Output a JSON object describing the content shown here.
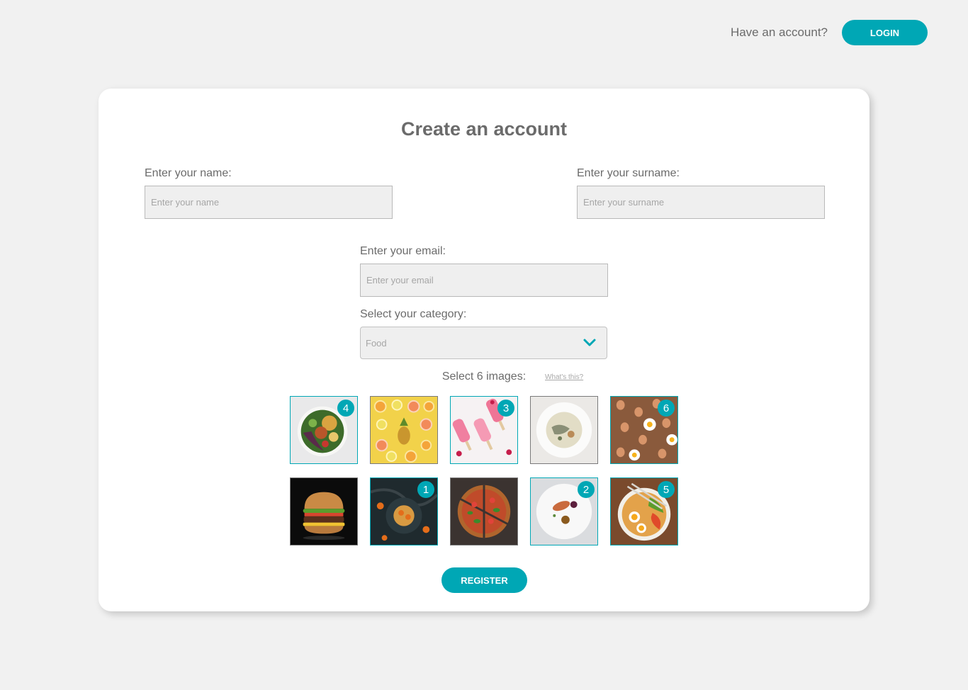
{
  "header": {
    "have_account_text": "Have an account?",
    "login_label": "LOGIN"
  },
  "form": {
    "title": "Create an account",
    "name": {
      "label": "Enter your name:",
      "placeholder": "Enter your name",
      "value": ""
    },
    "surname": {
      "label": "Enter your surname:",
      "placeholder": "Enter your surname",
      "value": ""
    },
    "email": {
      "label": "Enter your email:",
      "placeholder": "Enter your email",
      "value": ""
    },
    "category": {
      "label": "Select your category:",
      "selected": "Food"
    },
    "images": {
      "label": "Select 6 images:",
      "help_link": "What's this?",
      "tiles": [
        {
          "name": "salad-bowl-image",
          "order": "4"
        },
        {
          "name": "citrus-fruits-image",
          "order": ""
        },
        {
          "name": "popsicles-image",
          "order": "3"
        },
        {
          "name": "soup-plate-image",
          "order": ""
        },
        {
          "name": "fried-eggs-image",
          "order": "6"
        },
        {
          "name": "burger-image",
          "order": ""
        },
        {
          "name": "pancakes-image",
          "order": "1"
        },
        {
          "name": "pizza-image",
          "order": ""
        },
        {
          "name": "plated-dish-image",
          "order": "2"
        },
        {
          "name": "ramen-bowl-image",
          "order": "5"
        }
      ]
    },
    "register_label": "REGISTER"
  },
  "colors": {
    "accent": "#00a7b5",
    "background": "#f1f1f1",
    "card": "#ffffff",
    "text": "#6b6b6b"
  }
}
